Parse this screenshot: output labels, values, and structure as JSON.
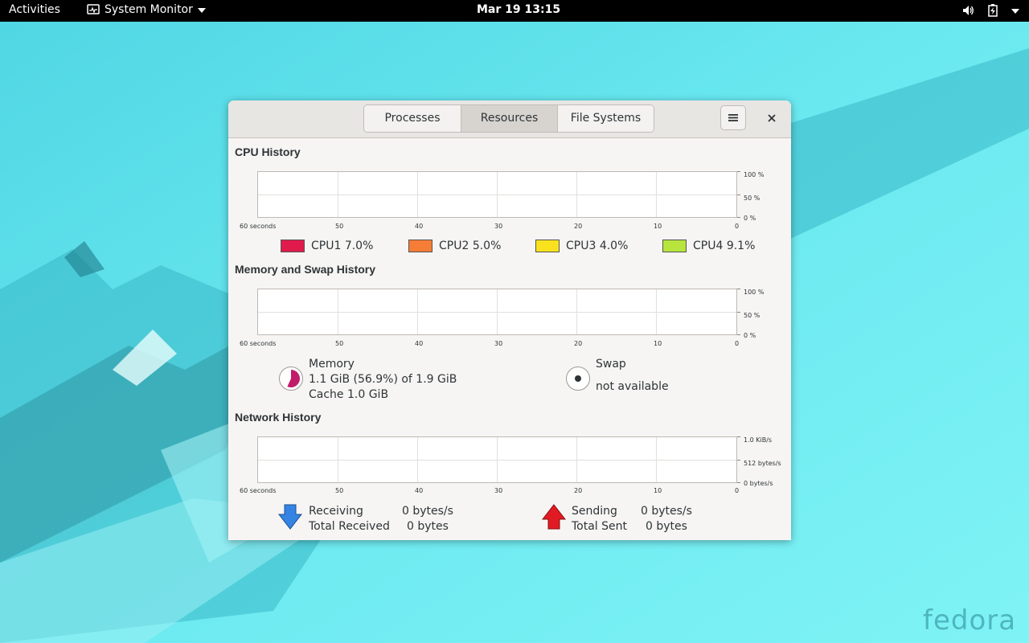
{
  "topbar": {
    "activities": "Activities",
    "app_name": "System Monitor",
    "clock": "Mar 19  13:15",
    "tray_icons": [
      "volume-icon",
      "battery-icon",
      "system-menu-caret-icon"
    ]
  },
  "window": {
    "tabs": [
      {
        "label": "Processes",
        "active": false
      },
      {
        "label": "Resources",
        "active": true
      },
      {
        "label": "File Systems",
        "active": false
      }
    ],
    "menu_icon": "hamburger-icon",
    "close_icon": "close-icon"
  },
  "cpu": {
    "title": "CPU History",
    "x_labels": [
      "60 seconds",
      "50",
      "40",
      "30",
      "20",
      "10",
      "0"
    ],
    "y_labels": [
      "100 %",
      "50 %",
      "0 %"
    ],
    "legend": [
      {
        "label": "CPU1",
        "value": "7.0%",
        "color": "#e01b4c"
      },
      {
        "label": "CPU2",
        "value": "5.0%",
        "color": "#f57d36"
      },
      {
        "label": "CPU3",
        "value": "4.0%",
        "color": "#f9e21d"
      },
      {
        "label": "CPU4",
        "value": "9.1%",
        "color": "#b7e53e"
      }
    ]
  },
  "memory": {
    "title": "Memory and Swap History",
    "x_labels": [
      "60 seconds",
      "50",
      "40",
      "30",
      "20",
      "10",
      "0"
    ],
    "y_labels": [
      "100 %",
      "50 %",
      "0 %"
    ],
    "memory_label": "Memory",
    "memory_usage": "1.1 GiB (56.9%) of 1.9 GiB",
    "cache": "Cache 1.0 GiB",
    "memory_fraction": 0.569,
    "memory_color": "#c01c6a",
    "swap_label": "Swap",
    "swap_status": "not available"
  },
  "network": {
    "title": "Network History",
    "x_labels": [
      "60 seconds",
      "50",
      "40",
      "30",
      "20",
      "10",
      "0"
    ],
    "y_labels": [
      "1.0 KiB/s",
      "512 bytes/s",
      "0 bytes/s"
    ],
    "receiving_label": "Receiving",
    "receiving_value": "0 bytes/s",
    "total_received_label": "Total Received",
    "total_received_value": "0 bytes",
    "sending_label": "Sending",
    "sending_value": "0 bytes/s",
    "total_sent_label": "Total Sent",
    "total_sent_value": "0 bytes"
  },
  "wallpaper": {
    "logo_text": "fedora"
  }
}
